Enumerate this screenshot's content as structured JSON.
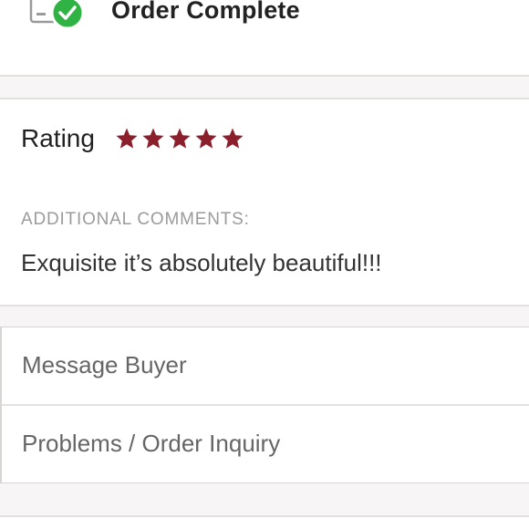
{
  "header": {
    "title": "Order Complete",
    "icon": "order-complete-check-icon",
    "check_color": "#2fb344"
  },
  "rating": {
    "label": "Rating",
    "stars_filled": 5,
    "stars_total": 5,
    "star_color": "#8b1f2c"
  },
  "comments": {
    "heading": "ADDITIONAL COMMENTS:",
    "text": "Exquisite it’s absolutely beautiful!!!"
  },
  "actions": {
    "items": [
      {
        "label": "Message Buyer"
      },
      {
        "label": "Problems / Order Inquiry"
      }
    ]
  }
}
